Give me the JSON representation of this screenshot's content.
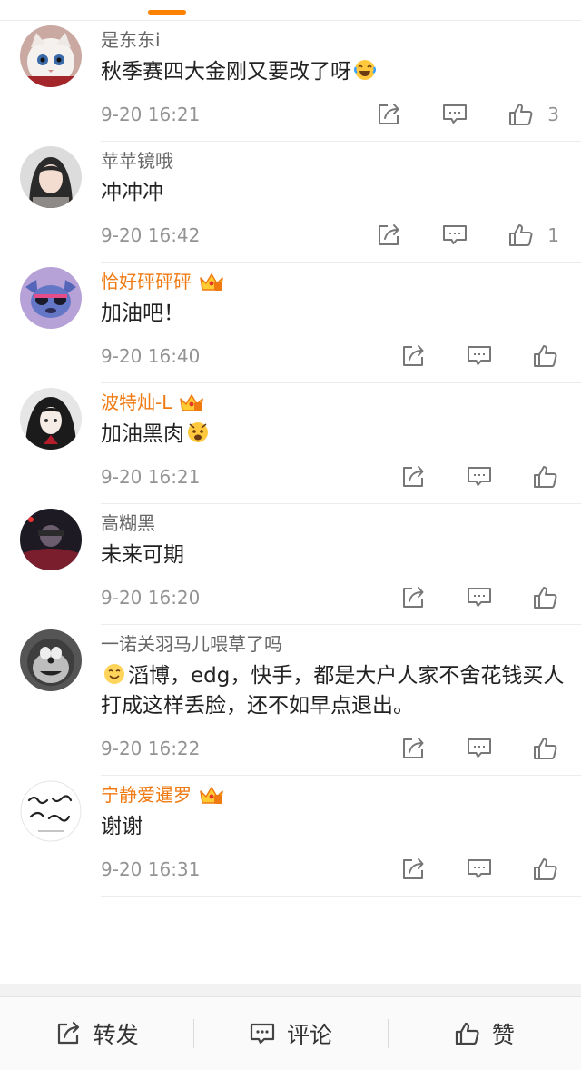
{
  "comments": [
    {
      "name": "是东东i",
      "vip": false,
      "pre_emoji": "",
      "text": "秋季赛四大金刚又要改了呀",
      "post_emoji": "laugh-tears",
      "time": "9-20 16:21",
      "likes": "3"
    },
    {
      "name": "苹苹镜哦",
      "vip": false,
      "pre_emoji": "",
      "text": "冲冲冲",
      "post_emoji": "",
      "time": "9-20 16:42",
      "likes": "1"
    },
    {
      "name": "恰好砰砰砰",
      "vip": true,
      "pre_emoji": "",
      "text": "加油吧！",
      "post_emoji": "",
      "time": "9-20 16:40",
      "likes": ""
    },
    {
      "name": "波特灿-L",
      "vip": true,
      "pre_emoji": "",
      "text": "加油黑肉",
      "post_emoji": "scared",
      "time": "9-20 16:21",
      "likes": ""
    },
    {
      "name": "高糊黑",
      "vip": false,
      "pre_emoji": "",
      "text": "未来可期",
      "post_emoji": "",
      "time": "9-20 16:20",
      "likes": ""
    },
    {
      "name": "一诺关羽马儿喂草了吗",
      "vip": false,
      "pre_emoji": "smile",
      "text": "滔博，edg，快手，都是大户人家不舍花钱买人打成这样丢脸，还不如早点退出。",
      "post_emoji": "",
      "time": "9-20 16:22",
      "likes": ""
    },
    {
      "name": "宁静爱暹罗",
      "vip": true,
      "pre_emoji": "",
      "text": "谢谢",
      "post_emoji": "",
      "time": "9-20 16:31",
      "likes": ""
    }
  ],
  "bottom_bar": {
    "repost": "转发",
    "comment": "评论",
    "like": "赞"
  },
  "colors": {
    "accent": "#ff8200",
    "vip_name": "#f07a12",
    "time": "#939393"
  },
  "icons": [
    "repost-icon",
    "comment-icon",
    "like-icon",
    "vip-crown-icon"
  ]
}
